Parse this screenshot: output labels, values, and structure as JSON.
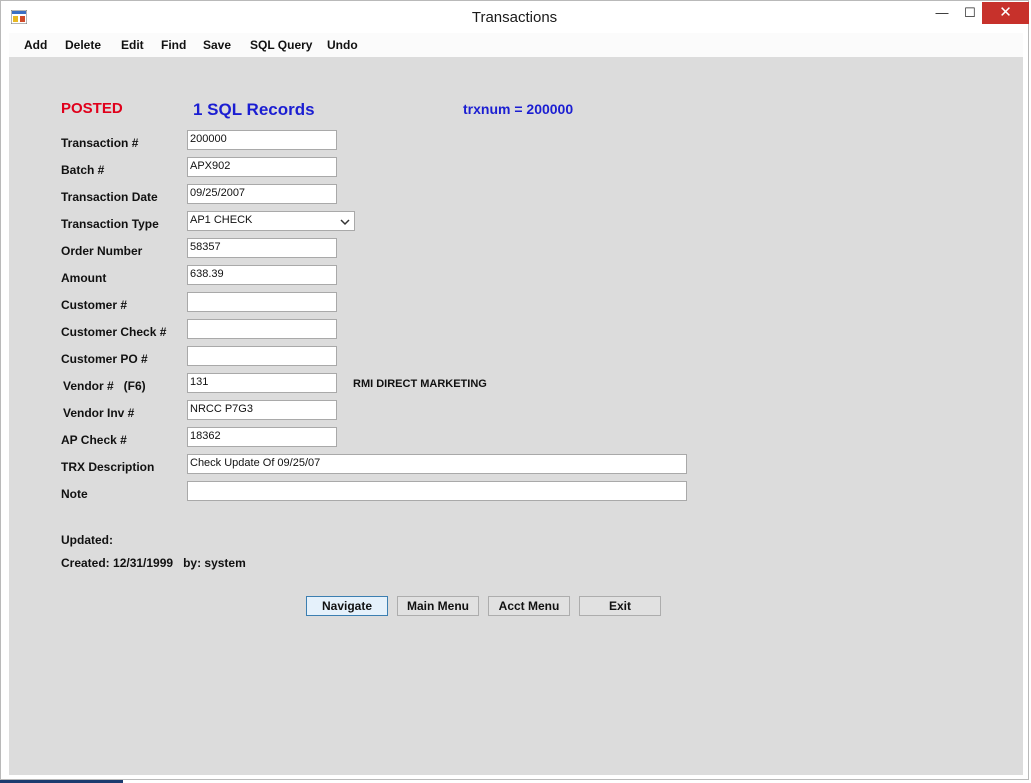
{
  "window": {
    "title": "Transactions",
    "min_glyph": "—",
    "max_glyph": "☐",
    "close_glyph": "✕"
  },
  "menu": [
    "Add",
    "Delete",
    "Edit",
    "Find",
    "Save",
    "SQL Query",
    "Undo"
  ],
  "status": {
    "posted": "POSTED",
    "records": "1 SQL Records",
    "trxnum": "trxnum = 200000"
  },
  "fields": {
    "transaction_num": {
      "label": "Transaction #",
      "value": "200000"
    },
    "batch_num": {
      "label": "Batch #",
      "value": "APX902"
    },
    "transaction_date": {
      "label": "Transaction Date",
      "value": "09/25/2007"
    },
    "transaction_type": {
      "label": "Transaction Type",
      "value": "AP1 CHECK"
    },
    "order_number": {
      "label": "Order Number",
      "value": "58357"
    },
    "amount": {
      "label": "Amount",
      "value": "638.39"
    },
    "customer_num": {
      "label": "Customer #",
      "value": ""
    },
    "customer_check": {
      "label": "Customer Check #",
      "value": ""
    },
    "customer_po": {
      "label": "Customer PO #",
      "value": ""
    },
    "vendor_num": {
      "label": "Vendor #   (F6)",
      "value": "131",
      "name": "RMI DIRECT MARKETING"
    },
    "vendor_inv": {
      "label": "Vendor Inv #",
      "value": "NRCC P7G3"
    },
    "ap_check": {
      "label": "AP Check #",
      "value": "18362"
    },
    "trx_description": {
      "label": "TRX Description",
      "value": "Check Update Of 09/25/07"
    },
    "note": {
      "label": "Note",
      "value": ""
    }
  },
  "audit": {
    "updated": "Updated:",
    "created": "Created: 12/31/1999   by: system"
  },
  "buttons": {
    "navigate": "Navigate",
    "main_menu": "Main Menu",
    "acct_menu": "Acct Menu",
    "exit": "Exit"
  },
  "colors": {
    "posted": "#e0001b",
    "info_blue": "#1b1ed2",
    "close_button": "#c7312b",
    "client_background": "#dcdcdc"
  }
}
